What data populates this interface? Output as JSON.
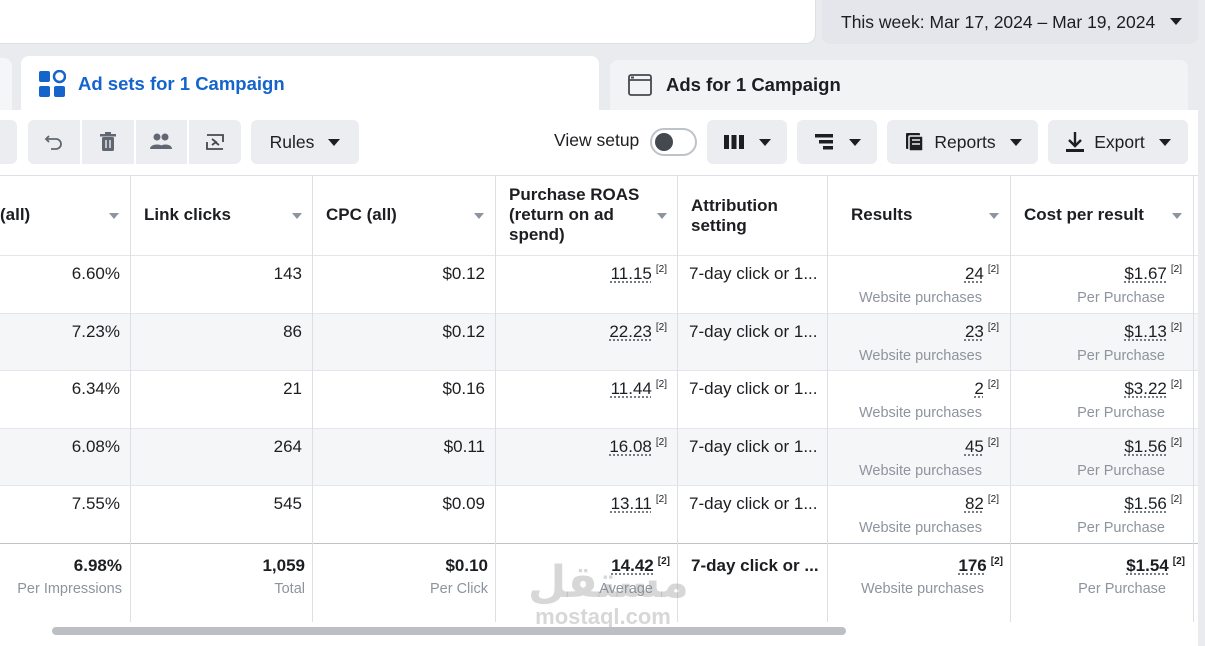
{
  "date_range": {
    "label": "This week: Mar 17, 2024 – Mar 19, 2024"
  },
  "tabs": [
    {
      "label": "Ad sets for 1 Campaign",
      "active": true,
      "icon": "grid-icon"
    },
    {
      "label": "Ads for 1 Campaign",
      "active": false,
      "icon": "ad-window-icon"
    }
  ],
  "toolbar": {
    "rules_label": "Rules",
    "view_setup_label": "View setup",
    "view_setup_on": false,
    "reports_label": "Reports",
    "export_label": "Export",
    "icons": [
      "undo-icon",
      "trash-icon",
      "people-icon",
      "duplicate-icon",
      "columns-icon",
      "breakdown-icon",
      "reports-icon",
      "download-icon"
    ]
  },
  "columns": {
    "ctr": "(all)",
    "link_clicks": "Link clicks",
    "cpc": "CPC (all)",
    "roas": "Purchase ROAS (return on ad spend)",
    "attribution": "Attribution setting",
    "results": "Results",
    "cost_per_result": "Cost per result"
  },
  "rows": [
    {
      "ctr": "6.60%",
      "link_clicks": "143",
      "cpc": "$0.12",
      "roas": "11.15",
      "attribution": "7-day click or 1...",
      "results": "24",
      "results_sub": "Website purchases",
      "cpr": "$1.67",
      "cpr_sub": "Per Purchase"
    },
    {
      "ctr": "7.23%",
      "link_clicks": "86",
      "cpc": "$0.12",
      "roas": "22.23",
      "attribution": "7-day click or 1...",
      "results": "23",
      "results_sub": "Website purchases",
      "cpr": "$1.13",
      "cpr_sub": "Per Purchase"
    },
    {
      "ctr": "6.34%",
      "link_clicks": "21",
      "cpc": "$0.16",
      "roas": "11.44",
      "attribution": "7-day click or 1...",
      "results": "2",
      "results_sub": "Website purchases",
      "cpr": "$3.22",
      "cpr_sub": "Per Purchase"
    },
    {
      "ctr": "6.08%",
      "link_clicks": "264",
      "cpc": "$0.11",
      "roas": "16.08",
      "attribution": "7-day click or 1...",
      "results": "45",
      "results_sub": "Website purchases",
      "cpr": "$1.56",
      "cpr_sub": "Per Purchase"
    },
    {
      "ctr": "7.55%",
      "link_clicks": "545",
      "cpc": "$0.09",
      "roas": "13.11",
      "attribution": "7-day click or 1...",
      "results": "82",
      "results_sub": "Website purchases",
      "cpr": "$1.56",
      "cpr_sub": "Per Purchase"
    }
  ],
  "footnote_marker": "[2]",
  "totals": {
    "ctr": "6.98%",
    "ctr_sub": "Per Impressions",
    "link_clicks": "1,059",
    "link_clicks_sub": "Total",
    "cpc": "$0.10",
    "cpc_sub": "Per Click",
    "roas": "14.42",
    "roas_sub": "Average",
    "attribution": "7-day click or ...",
    "results": "176",
    "results_sub": "Website purchases",
    "cpr": "$1.54",
    "cpr_sub": "Per Purchase"
  },
  "watermark": {
    "arabic": "مستقل",
    "latin": "mostaql.com"
  },
  "colors": {
    "accent": "#1464cc",
    "toolbar_bg": "#ebedf0",
    "band": "#f5f6f7"
  }
}
